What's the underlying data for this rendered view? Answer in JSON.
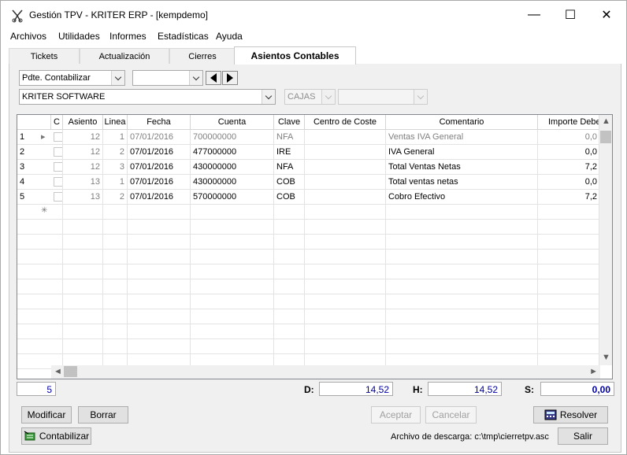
{
  "window": {
    "title": "Gestión TPV - KRITER ERP - [kempdemo]",
    "minimize": "—",
    "maximize": "☐",
    "close": "✕"
  },
  "menu": [
    "Archivos",
    "Utilidades",
    "Informes",
    "Estadísticas",
    "Ayuda"
  ],
  "tabs": [
    "Tickets",
    "Actualización",
    "Cierres",
    "Asientos Contables"
  ],
  "active_tab": "Asientos Contables",
  "filters": {
    "estado": "Pdte. Contabilizar",
    "periodo": "",
    "empresa": "KRITER SOFTWARE",
    "cajas": "CAJAS",
    "caja_valor": ""
  },
  "grid": {
    "columns": [
      "C",
      "Asiento",
      "Linea",
      "Fecha",
      "Cuenta",
      "Clave",
      "Centro de Coste",
      "Comentario",
      "Importe Debe"
    ],
    "rows": [
      {
        "n": "1",
        "asiento": "12",
        "linea": "1",
        "fecha": "07/01/2016",
        "cuenta": "700000000",
        "clave": "NFA",
        "centro": "",
        "comentario": "Ventas IVA General",
        "importe": "0,0",
        "gray": true
      },
      {
        "n": "2",
        "asiento": "12",
        "linea": "2",
        "fecha": "07/01/2016",
        "cuenta": "477000000",
        "clave": "IRE",
        "centro": "",
        "comentario": "IVA General",
        "importe": "0,0",
        "gray": false
      },
      {
        "n": "3",
        "asiento": "12",
        "linea": "3",
        "fecha": "07/01/2016",
        "cuenta": "430000000",
        "clave": "NFA",
        "centro": "",
        "comentario": "Total Ventas Netas",
        "importe": "7,2",
        "gray": false
      },
      {
        "n": "4",
        "asiento": "13",
        "linea": "1",
        "fecha": "07/01/2016",
        "cuenta": "430000000",
        "clave": "COB",
        "centro": "",
        "comentario": "Total ventas netas",
        "importe": "0,0",
        "gray": false
      },
      {
        "n": "5",
        "asiento": "13",
        "linea": "2",
        "fecha": "07/01/2016",
        "cuenta": "570000000",
        "clave": "COB",
        "centro": "",
        "comentario": "Cobro Efectivo",
        "importe": "7,2",
        "gray": false
      }
    ],
    "new_row_marker": "✳"
  },
  "footer": {
    "count": "5",
    "d_label": "D:",
    "d_value": "14,52",
    "h_label": "H:",
    "h_value": "14,52",
    "s_label": "S:",
    "s_value": "0,00"
  },
  "buttons": {
    "modificar": "Modificar",
    "borrar": "Borrar",
    "aceptar": "Aceptar",
    "cancelar": "Cancelar",
    "resolver": "Resolver",
    "contabilizar": "Contabilizar",
    "salir": "Salir"
  },
  "archivo_descarga": "Archivo de descarga: c:\\tmp\\cierretpv.asc",
  "colors": {
    "accent_blue": "#0000a0",
    "disabled_gray": "#a0a0a0"
  }
}
